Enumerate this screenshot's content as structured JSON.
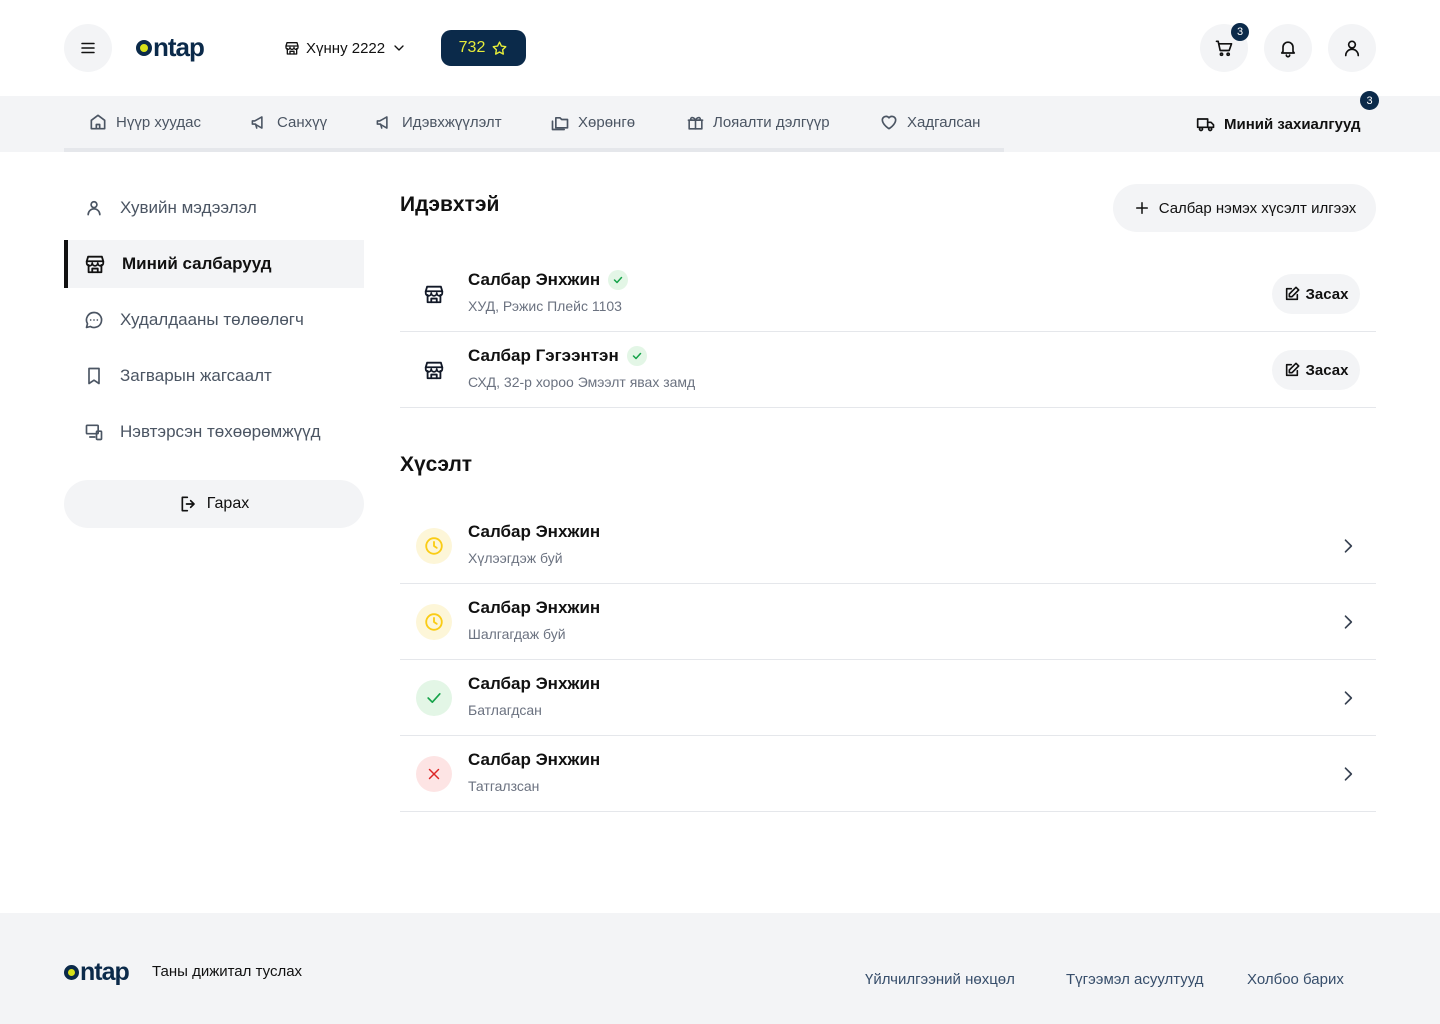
{
  "header": {
    "logo_text": "ntap",
    "branch": "Хүнну 2222",
    "points": "732",
    "cart_count": "3"
  },
  "nav": {
    "items": [
      {
        "label": "Нүүр хуудас",
        "icon": "home-icon"
      },
      {
        "label": "Санхүү",
        "icon": "megaphone-icon"
      },
      {
        "label": "Идэвхжүүлэлт",
        "icon": "megaphone-icon"
      },
      {
        "label": "Хөрөнгө",
        "icon": "folders-icon"
      },
      {
        "label": "Лояалти дэлгүүр",
        "icon": "gift-icon"
      },
      {
        "label": "Хадгалсан",
        "icon": "heart-icon"
      }
    ],
    "orders_label": "Миний захиалгууд",
    "orders_count": "3"
  },
  "sidebar": {
    "items": [
      {
        "label": "Хувийн мэдээлэл",
        "icon": "user-icon"
      },
      {
        "label": "Миний салбарууд",
        "icon": "store-icon",
        "active": true
      },
      {
        "label": "Худалдааны төлөөлөгч",
        "icon": "chat-icon"
      },
      {
        "label": "Загварын жагсаалт",
        "icon": "bookmark-icon"
      },
      {
        "label": "Нэвтэрсэн төхөөрөмжүүд",
        "icon": "devices-icon"
      }
    ],
    "logout_label": "Гарах"
  },
  "active": {
    "title": "Идэвхтэй",
    "add_label": "Салбар нэмэх хүсэлт илгээх",
    "edit_label": "Засах",
    "branches": [
      {
        "name": "Салбар Энхжин",
        "address": "ХУД, Рэжис Плейс 1103"
      },
      {
        "name": "Салбар Гэгээнтэн",
        "address": "СХД, 32-р хороо Эмээлт явах замд"
      }
    ]
  },
  "requests": {
    "title": "Хүсэлт",
    "items": [
      {
        "name": "Салбар Энхжин",
        "status": "Хүлээгдэж буй",
        "state": "pending"
      },
      {
        "name": "Салбар Энхжин",
        "status": "Шалгагдаж буй",
        "state": "pending"
      },
      {
        "name": "Салбар Энхжин",
        "status": "Батлагдсан",
        "state": "approved"
      },
      {
        "name": "Салбар Энхжин",
        "status": "Татгалзсан",
        "state": "rejected"
      }
    ]
  },
  "footer": {
    "logo_text": "ntap",
    "tagline": "Таны дижитал туслах",
    "links": [
      "Үйлчилгээний нөхцөл",
      "Түгээмэл асуултууд",
      "Холбоо барих"
    ]
  },
  "colors": {
    "brand_navy": "#0b2a4a",
    "brand_lime": "#d8e21a",
    "pending": "#facc15",
    "approved": "#16a34a",
    "rejected": "#dc2626"
  }
}
